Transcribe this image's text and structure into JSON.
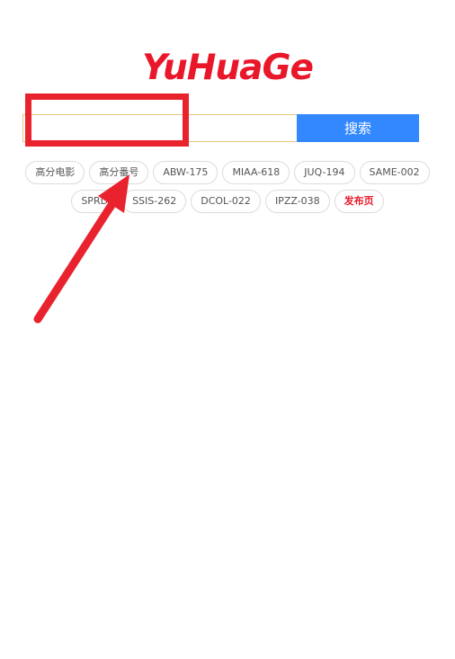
{
  "logo": {
    "text": "YuHuaGe"
  },
  "search": {
    "value": "",
    "placeholder": "",
    "button_label": "搜索"
  },
  "tags": {
    "row1": [
      "高分电影",
      "高分番号",
      "ABW-175",
      "MIAA-618",
      "JUQ-194",
      "SAME-002"
    ],
    "row2": [
      "SPRD",
      "SSIS-262",
      "DCOL-022",
      "IPZZ-038"
    ],
    "publish_label": "发布页"
  },
  "annotation": {
    "highlight": "search-input",
    "arrow_target": "高分番号"
  },
  "colors": {
    "logo": "#e8182a",
    "search_button": "#3388ff",
    "publish_tag": "#e8182a",
    "annotation": "#e8232e",
    "input_border": "#e3c878"
  }
}
